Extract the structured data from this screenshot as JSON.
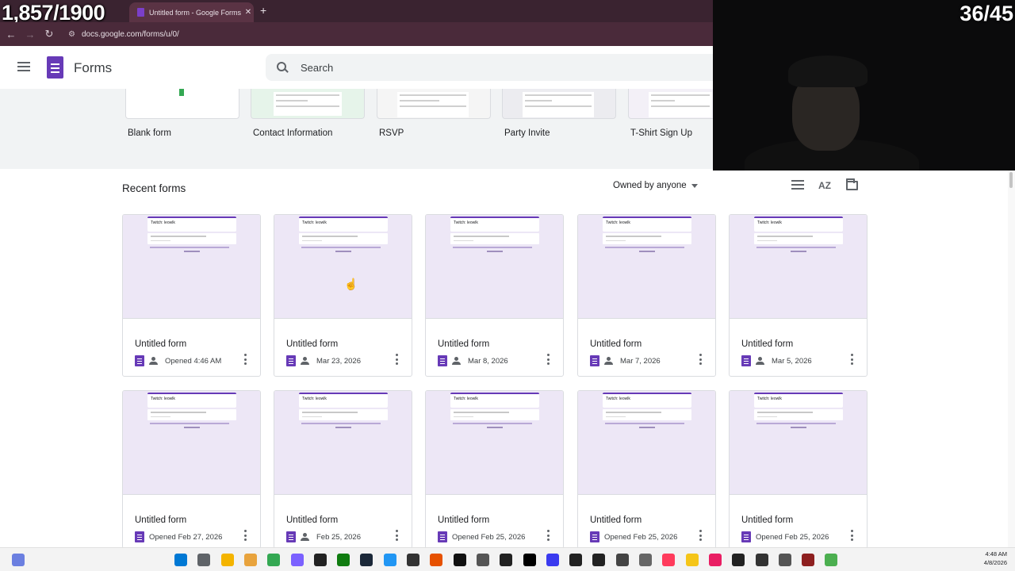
{
  "overlay": {
    "counter_left": "1,857/1900",
    "counter_right": "36/45"
  },
  "browser": {
    "tab_title": "Untitled form - Google Forms",
    "tab_close": "✕",
    "new_tab": "+",
    "url": "docs.google.com/forms/u/0/"
  },
  "header": {
    "app_name": "Forms",
    "search_placeholder": "Search"
  },
  "templates": [
    {
      "label": "Blank form"
    },
    {
      "label": "Contact Information"
    },
    {
      "label": "RSVP"
    },
    {
      "label": "Party Invite"
    },
    {
      "label": "T-Shirt Sign Up"
    }
  ],
  "recent": {
    "title": "Recent forms",
    "owner_filter": "Owned by anyone",
    "sort_label": "AZ",
    "preview_heading": "Twitch: leowlk",
    "forms": [
      {
        "name": "Untitled form",
        "meta": "Opened 4:46 AM",
        "shared": true
      },
      {
        "name": "Untitled form",
        "meta": "Mar 23, 2026",
        "shared": true
      },
      {
        "name": "Untitled form",
        "meta": "Mar 8, 2026",
        "shared": true
      },
      {
        "name": "Untitled form",
        "meta": "Mar 7, 2026",
        "shared": true
      },
      {
        "name": "Untitled form",
        "meta": "Mar 5, 2026",
        "shared": true
      },
      {
        "name": "Untitled form",
        "meta": "Opened Feb 27, 2026",
        "shared": false
      },
      {
        "name": "Untitled form",
        "meta": "Feb 25, 2026",
        "shared": true
      },
      {
        "name": "Untitled form",
        "meta": "Opened Feb 25, 2026",
        "shared": false
      },
      {
        "name": "Untitled form",
        "meta": "Opened Feb 25, 2026",
        "shared": false
      },
      {
        "name": "Untitled form",
        "meta": "Opened Feb 25, 2026",
        "shared": false
      }
    ]
  },
  "taskbar": {
    "time": "4:48 AM",
    "date": "4/8/2026"
  },
  "colors": {
    "forms_purple": "#673ab7",
    "preview_bg": "#ede7f6",
    "tabbar": "#3a2330"
  }
}
